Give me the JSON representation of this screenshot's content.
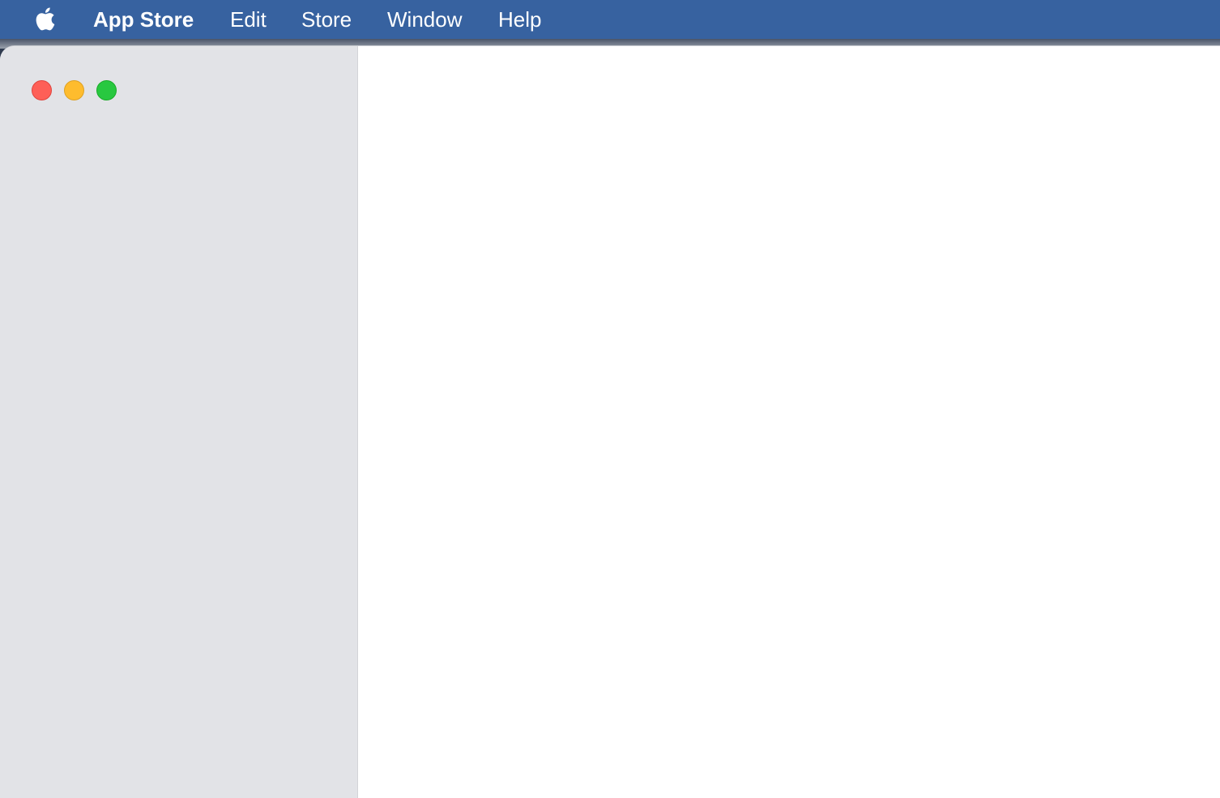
{
  "menubar": {
    "apple_icon": "apple-logo-icon",
    "app_name": "App Store",
    "items": [
      "Edit",
      "Store",
      "Window",
      "Help"
    ]
  },
  "window": {
    "controls": [
      "close",
      "minimize",
      "zoom"
    ],
    "colors": {
      "close": "#fe5f57",
      "minimize": "#febc2e",
      "zoom": "#28c840",
      "menubar": "#3762a0",
      "sidebar": "#e2e3e7"
    }
  }
}
